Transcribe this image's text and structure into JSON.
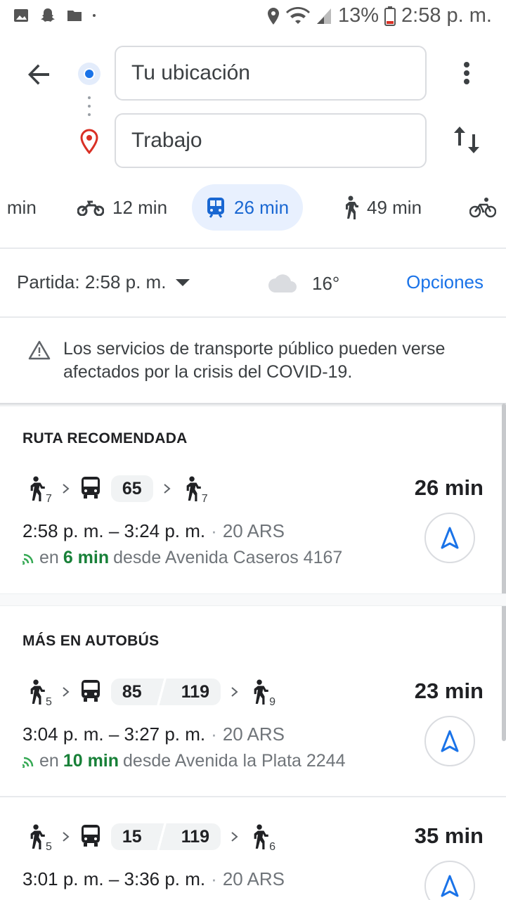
{
  "status_bar": {
    "battery": "13%",
    "time": "2:58 p. m."
  },
  "search": {
    "origin": "Tu ubicación",
    "destination": "Trabajo"
  },
  "modes": [
    {
      "icon": "car-icon",
      "time": "· min"
    },
    {
      "icon": "motorcycle-icon",
      "time": "12 min"
    },
    {
      "icon": "train-icon",
      "time": "26 min",
      "active": true
    },
    {
      "icon": "walk-icon",
      "time": "49 min"
    },
    {
      "icon": "bike-icon",
      "time": ""
    }
  ],
  "departure": {
    "label": "Partida: 2:58 p. m.",
    "weather_temp": "16°",
    "options_label": "Opciones"
  },
  "alert": {
    "text": "Los servicios de transporte público pueden verse afectados por la crisis del COVID-19."
  },
  "recommended": {
    "title": "RUTA RECOMENDADA",
    "walk_before": "7",
    "line": "65",
    "walk_after": "7",
    "duration": "26 min",
    "times": "2:58 p. m. – 3:24 p. m.",
    "price": "20 ARS",
    "live_prefix": "en",
    "live_mins": "6 min",
    "live_suffix": "desde Avenida Caseros 4167"
  },
  "more_bus": {
    "title": "MÁS EN AUTOBÚS",
    "routes": [
      {
        "walk_before": "5",
        "line_a": "85",
        "line_b": "119",
        "walk_after": "9",
        "duration": "23 min",
        "times": "3:04 p. m. – 3:27 p. m.",
        "price": "20 ARS",
        "live_prefix": "en",
        "live_mins": "10 min",
        "live_suffix": "desde Avenida la Plata 2244"
      },
      {
        "walk_before": "5",
        "line_a": "15",
        "line_b": "119",
        "walk_after": "6",
        "duration": "35 min",
        "times": "3:01 p. m. – 3:36 p. m.",
        "price": "20 ARS"
      }
    ]
  },
  "colors": {
    "accent": "#1a73e8",
    "live": "#188038",
    "active_mode_bg": "#e8f0fe"
  }
}
